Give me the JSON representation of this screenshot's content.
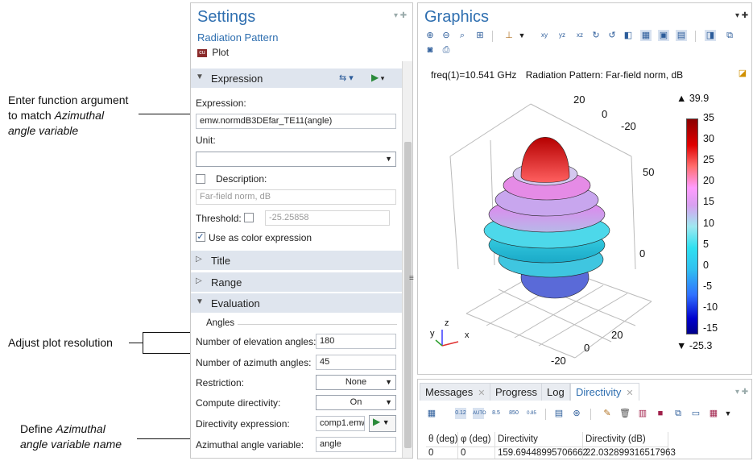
{
  "annotations": {
    "a1_line1": "Enter function argument",
    "a1_line2": "to match ",
    "a1_em": "Azimuthal",
    "a1_line3": "angle variable",
    "a2": "Adjust plot resolution",
    "a3_line1": "Define ",
    "a3_em1": "Azimuthal",
    "a3_line2": "angle variable name"
  },
  "settings": {
    "title": "Settings",
    "subtitle": "Radiation Pattern",
    "plot_button": "Plot",
    "sections": {
      "expression": "Expression",
      "title": "Title",
      "range": "Range",
      "evaluation": "Evaluation"
    },
    "expression_label": "Expression:",
    "expression_value": "emw.normdB3DEfar_TE11(angle)",
    "unit_label": "Unit:",
    "unit_value": "",
    "description_label": "Description:",
    "description_value": "Far-field norm, dB",
    "threshold_label": "Threshold:",
    "threshold_value": "-25.25858",
    "use_color_label": "Use as color expression",
    "angles_label": "Angles",
    "elev_label": "Number of elevation angles:",
    "elev_value": "180",
    "azim_label": "Number of azimuth angles:",
    "azim_value": "45",
    "restriction_label": "Restriction:",
    "restriction_value": "None",
    "compute_dir_label": "Compute directivity:",
    "compute_dir_value": "On",
    "dir_expr_label": "Directivity expression:",
    "dir_expr_value": "comp1.emw",
    "az_var_label": "Azimuthal angle variable:",
    "az_var_value": "angle"
  },
  "graphics": {
    "title": "Graphics",
    "caption_freq": "freq(1)=10.541 GHz",
    "caption_title": "Radiation Pattern: Far-field norm, dB",
    "max_label": "39.9",
    "min_label": "-25.3",
    "colorbar_ticks": [
      "35",
      "30",
      "25",
      "20",
      "15",
      "10",
      "5",
      "0",
      "-5",
      "-10",
      "-15"
    ],
    "axis_numbers": {
      "top20": "20",
      "top0": "0",
      "topm20": "-20",
      "side50": "50",
      "side0": "0",
      "bottom20": "20",
      "bottom0": "0",
      "bottomm20": "-20"
    },
    "triad": {
      "x": "x",
      "y": "y",
      "z": "z"
    },
    "colors": {
      "accent": "#2f6fb0",
      "colorbar_top": "#8b0000",
      "colorbar_bottom": "#00008b"
    }
  },
  "bottom": {
    "tabs": [
      "Messages",
      "Progress",
      "Log",
      "Directivity"
    ],
    "active_tab": "Directivity",
    "headers": [
      "θ (deg)",
      "φ (deg)",
      "Directivity",
      "Directivity (dB)"
    ],
    "row": [
      "0",
      "0",
      "159.69448995706662",
      "22.032899316517963"
    ]
  }
}
